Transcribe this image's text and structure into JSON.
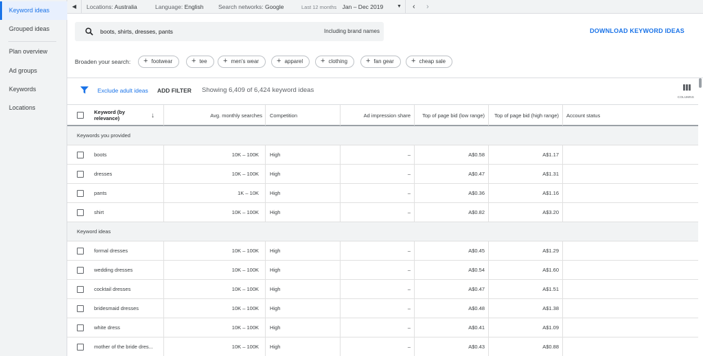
{
  "sidebar": {
    "items": [
      {
        "label": "Keyword ideas"
      },
      {
        "label": "Grouped ideas"
      },
      {
        "label": "Plan overview"
      },
      {
        "label": "Ad groups"
      },
      {
        "label": "Keywords"
      },
      {
        "label": "Locations"
      }
    ],
    "active_index": 0
  },
  "topbar": {
    "locations_key": "Locations:",
    "locations_value": "Australia",
    "language_key": "Language:",
    "language_value": "English",
    "networks_key": "Search networks:",
    "networks_value": "Google",
    "range_label": "Last 12 months",
    "range_value": "Jan – Dec 2019"
  },
  "search": {
    "query": "boots, shirts, dresses, pants",
    "brand_label": "Including brand names",
    "download_label": "DOWNLOAD KEYWORD IDEAS",
    "broaden_label": "Broaden your search:",
    "chips": [
      "footwear",
      "tee",
      "men's wear",
      "apparel",
      "clothing",
      "fan gear",
      "cheap sale"
    ]
  },
  "toolbar": {
    "exclude_label": "Exclude adult ideas",
    "add_filter_label": "ADD FILTER",
    "showing_text": "Showing 6,409 of 6,424 keyword ideas",
    "columns_label": "COLUMNS"
  },
  "table": {
    "headers": {
      "keyword": "Keyword (by relevance)",
      "searches": "Avg. monthly searches",
      "competition": "Competition",
      "impression": "Ad impression share",
      "bid_low": "Top of page bid (low range)",
      "bid_high": "Top of page bid (high range)",
      "status": "Account status"
    },
    "sections": [
      {
        "title": "Keywords you provided",
        "rows": [
          {
            "keyword": "boots",
            "searches": "10K – 100K",
            "competition": "High",
            "impression": "–",
            "bid_low": "A$0.58",
            "bid_high": "A$1.17"
          },
          {
            "keyword": "dresses",
            "searches": "10K – 100K",
            "competition": "High",
            "impression": "–",
            "bid_low": "A$0.47",
            "bid_high": "A$1.31"
          },
          {
            "keyword": "pants",
            "searches": "1K – 10K",
            "competition": "High",
            "impression": "–",
            "bid_low": "A$0.36",
            "bid_high": "A$1.16"
          },
          {
            "keyword": "shirt",
            "searches": "10K – 100K",
            "competition": "High",
            "impression": "–",
            "bid_low": "A$0.82",
            "bid_high": "A$3.20"
          }
        ]
      },
      {
        "title": "Keyword ideas",
        "rows": [
          {
            "keyword": "formal dresses",
            "searches": "10K – 100K",
            "competition": "High",
            "impression": "–",
            "bid_low": "A$0.45",
            "bid_high": "A$1.29"
          },
          {
            "keyword": "wedding dresses",
            "searches": "10K – 100K",
            "competition": "High",
            "impression": "–",
            "bid_low": "A$0.54",
            "bid_high": "A$1.60"
          },
          {
            "keyword": "cocktail dresses",
            "searches": "10K – 100K",
            "competition": "High",
            "impression": "–",
            "bid_low": "A$0.47",
            "bid_high": "A$1.51"
          },
          {
            "keyword": "bridesmaid dresses",
            "searches": "10K – 100K",
            "competition": "High",
            "impression": "–",
            "bid_low": "A$0.48",
            "bid_high": "A$1.38"
          },
          {
            "keyword": "white dress",
            "searches": "10K – 100K",
            "competition": "High",
            "impression": "–",
            "bid_low": "A$0.41",
            "bid_high": "A$1.09"
          },
          {
            "keyword": "mother of the bride dres...",
            "searches": "10K – 100K",
            "competition": "High",
            "impression": "–",
            "bid_low": "A$0.43",
            "bid_high": "A$0.88"
          }
        ]
      }
    ]
  },
  "colors": {
    "accent": "#1a73e8",
    "sidebar_bg": "#f1f3f4",
    "section_bg": "#f1f3f4"
  }
}
